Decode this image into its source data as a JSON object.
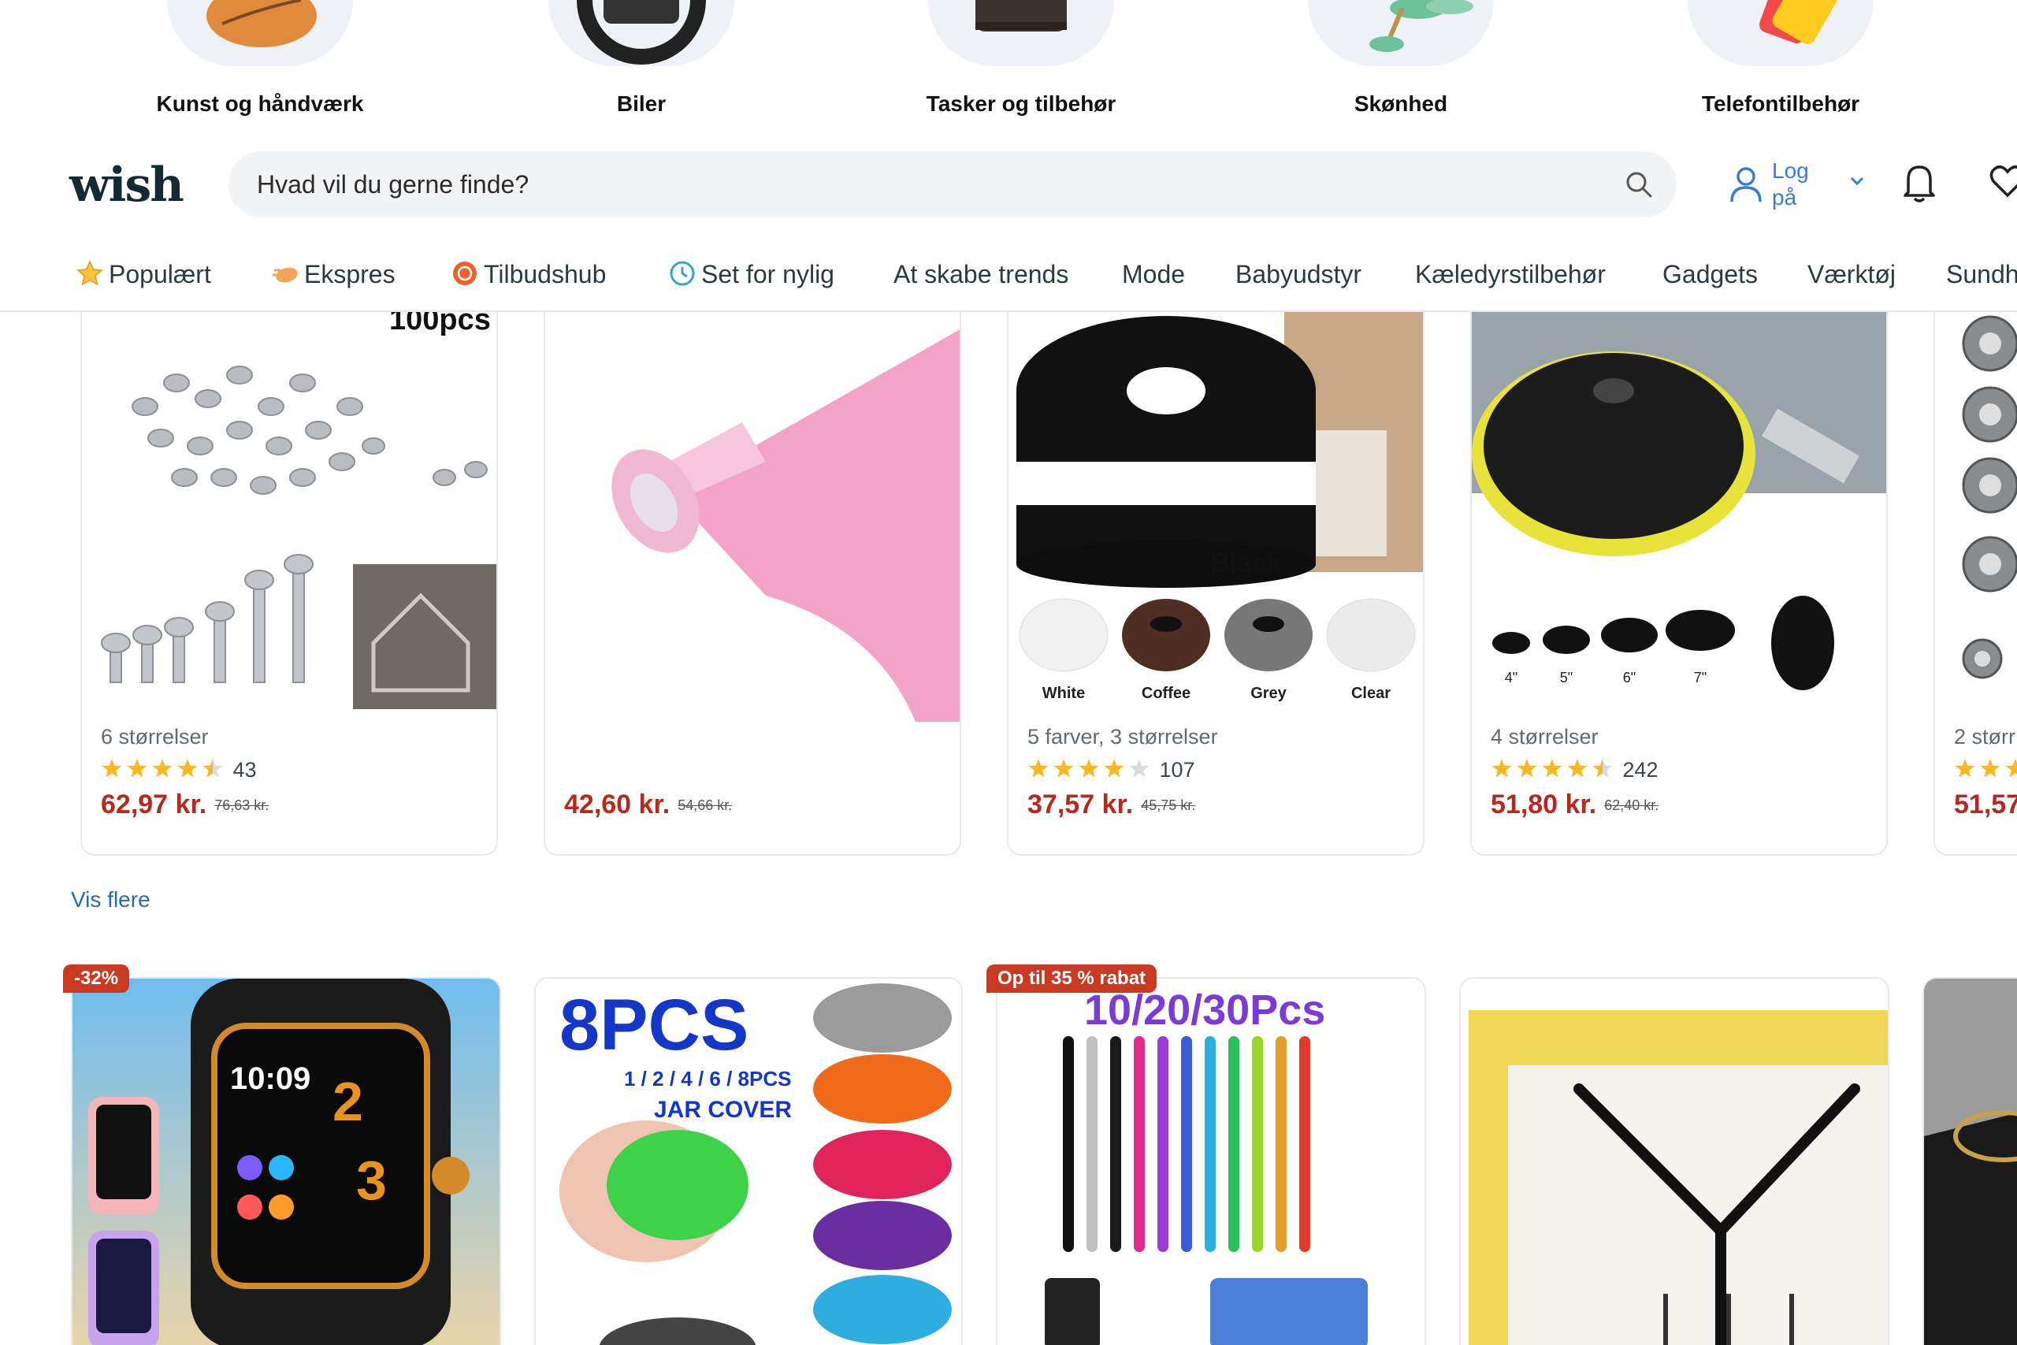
{
  "categories": [
    {
      "label": "Kunst og håndværk",
      "icon": "leaf-craft-icon"
    },
    {
      "label": "Biler",
      "icon": "steering-wheel-icon"
    },
    {
      "label": "Tasker og tilbehør",
      "icon": "bag-icon"
    },
    {
      "label": "Skønhed",
      "icon": "face-roller-icon"
    },
    {
      "label": "Telefontilbehør",
      "icon": "phone-case-icon"
    }
  ],
  "header": {
    "logo": "wish",
    "search_placeholder": "Hvad vil du gerne finde?",
    "login_label": "Log på"
  },
  "nav": [
    {
      "label": "Populært",
      "icon": "star-icon"
    },
    {
      "label": "Ekspres",
      "icon": "express-icon"
    },
    {
      "label": "Tilbudshub",
      "icon": "tag-icon"
    },
    {
      "label": "Set for nylig",
      "icon": "clock-icon"
    },
    {
      "label": "At skabe trends"
    },
    {
      "label": "Mode"
    },
    {
      "label": "Babyudstyr"
    },
    {
      "label": "Kæledyrstilbehør"
    },
    {
      "label": "Gadgets"
    },
    {
      "label": "Værktøj"
    },
    {
      "label": "Sundh"
    }
  ],
  "products": [
    {
      "meta": "6 størrelser",
      "stars": 4.5,
      "reviews": "43",
      "price": "62,97 kr.",
      "old_price": "76,63 kr.",
      "image_text": "100pcs"
    },
    {
      "meta": "",
      "stars": 0,
      "reviews": "",
      "price": "42,60 kr.",
      "old_price": "54,66 kr."
    },
    {
      "meta": "5 farver, 3 størrelser",
      "stars": 4,
      "reviews": "107",
      "price": "37,57 kr.",
      "old_price": "45,75 kr.",
      "image_text": "Black",
      "swatches": [
        "White",
        "Coffee",
        "Grey",
        "Clear"
      ]
    },
    {
      "meta": "4 størrelser",
      "stars": 4.5,
      "reviews": "242",
      "price": "51,80 kr.",
      "old_price": "62,40 kr.",
      "sizes": [
        "4\"",
        "5\"",
        "6\"",
        "7\""
      ]
    },
    {
      "meta": "2 størr",
      "stars": 4,
      "reviews": "",
      "price": "51,57",
      "old_price": ""
    }
  ],
  "vis_flere": "Vis flere",
  "row2": [
    {
      "badge": "-32%",
      "image_text": "10:09"
    },
    {
      "badge": "",
      "image_text": "8PCS",
      "image_sub": "1 / 2 / 4 / 6 / 8PCS",
      "image_sub2": "JAR COVER"
    },
    {
      "badge": "Op til 35 % rabat",
      "image_text": "10/20/30Pcs"
    },
    {
      "badge": "",
      "image_text": ""
    },
    {
      "badge": "",
      "image_text": ""
    }
  ],
  "colors": {
    "accent_blue": "#3a7dd0",
    "price_red": "#b7281e",
    "badge_red": "#c93a22",
    "star": "#f5b823"
  }
}
